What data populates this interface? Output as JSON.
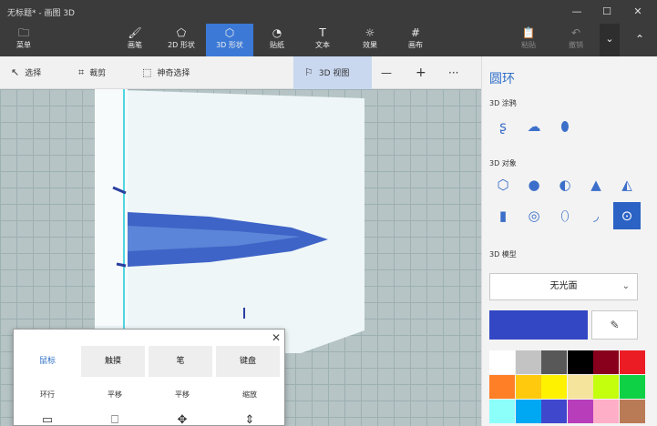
{
  "window": {
    "title": "无标题* - 画图 3D",
    "controls": {
      "minimize": "—",
      "maximize": "☐",
      "close": "✕"
    }
  },
  "ribbon": {
    "menu": {
      "label": "菜单",
      "icon": "folder-icon"
    },
    "tools": [
      {
        "label": "画笔",
        "icon": "brush-icon"
      },
      {
        "label": "2D 形状",
        "icon": "2d-shapes-icon"
      },
      {
        "label": "3D 形状",
        "icon": "3d-shapes-icon"
      },
      {
        "label": "贴纸",
        "icon": "sticker-icon"
      },
      {
        "label": "文本",
        "icon": "text-icon"
      },
      {
        "label": "效果",
        "icon": "effects-icon"
      },
      {
        "label": "画布",
        "icon": "canvas-icon"
      }
    ],
    "right": [
      {
        "label": "粘贴",
        "icon": "paste-icon"
      },
      {
        "label": "撤销",
        "icon": "undo-icon"
      }
    ],
    "more": "⌄",
    "collapse": "⌃"
  },
  "toolbar": {
    "select": "选择",
    "crop": "裁剪",
    "magic_select": "神奇选择",
    "view3d": "3D 视图",
    "zoom_out": "—",
    "zoom_in": "+",
    "more": "···"
  },
  "sidebar": {
    "title": "圆环",
    "doodle_section": "3D 涂鸦",
    "objects_section": "3D 对象",
    "models_section": "3D 模型",
    "finish_dropdown": "无光面",
    "current_color": "#3347c4",
    "swatches": [
      "#ffffff",
      "#c3c3c3",
      "#585858",
      "#000000",
      "#88001b",
      "#ec1c24",
      "#ff7f27",
      "#ffc90e",
      "#fff200",
      "#f5e49c",
      "#c4ff0e",
      "#0ed145",
      "#8cfffb",
      "#00a8f3",
      "#3f48cc",
      "#b83dba",
      "#ffaec8",
      "#b97a56"
    ]
  },
  "help_popup": {
    "tabs": [
      "鼠标",
      "触摸",
      "笔",
      "键盘"
    ],
    "actions": [
      "环行",
      "平移",
      "平移",
      "缩放"
    ]
  }
}
